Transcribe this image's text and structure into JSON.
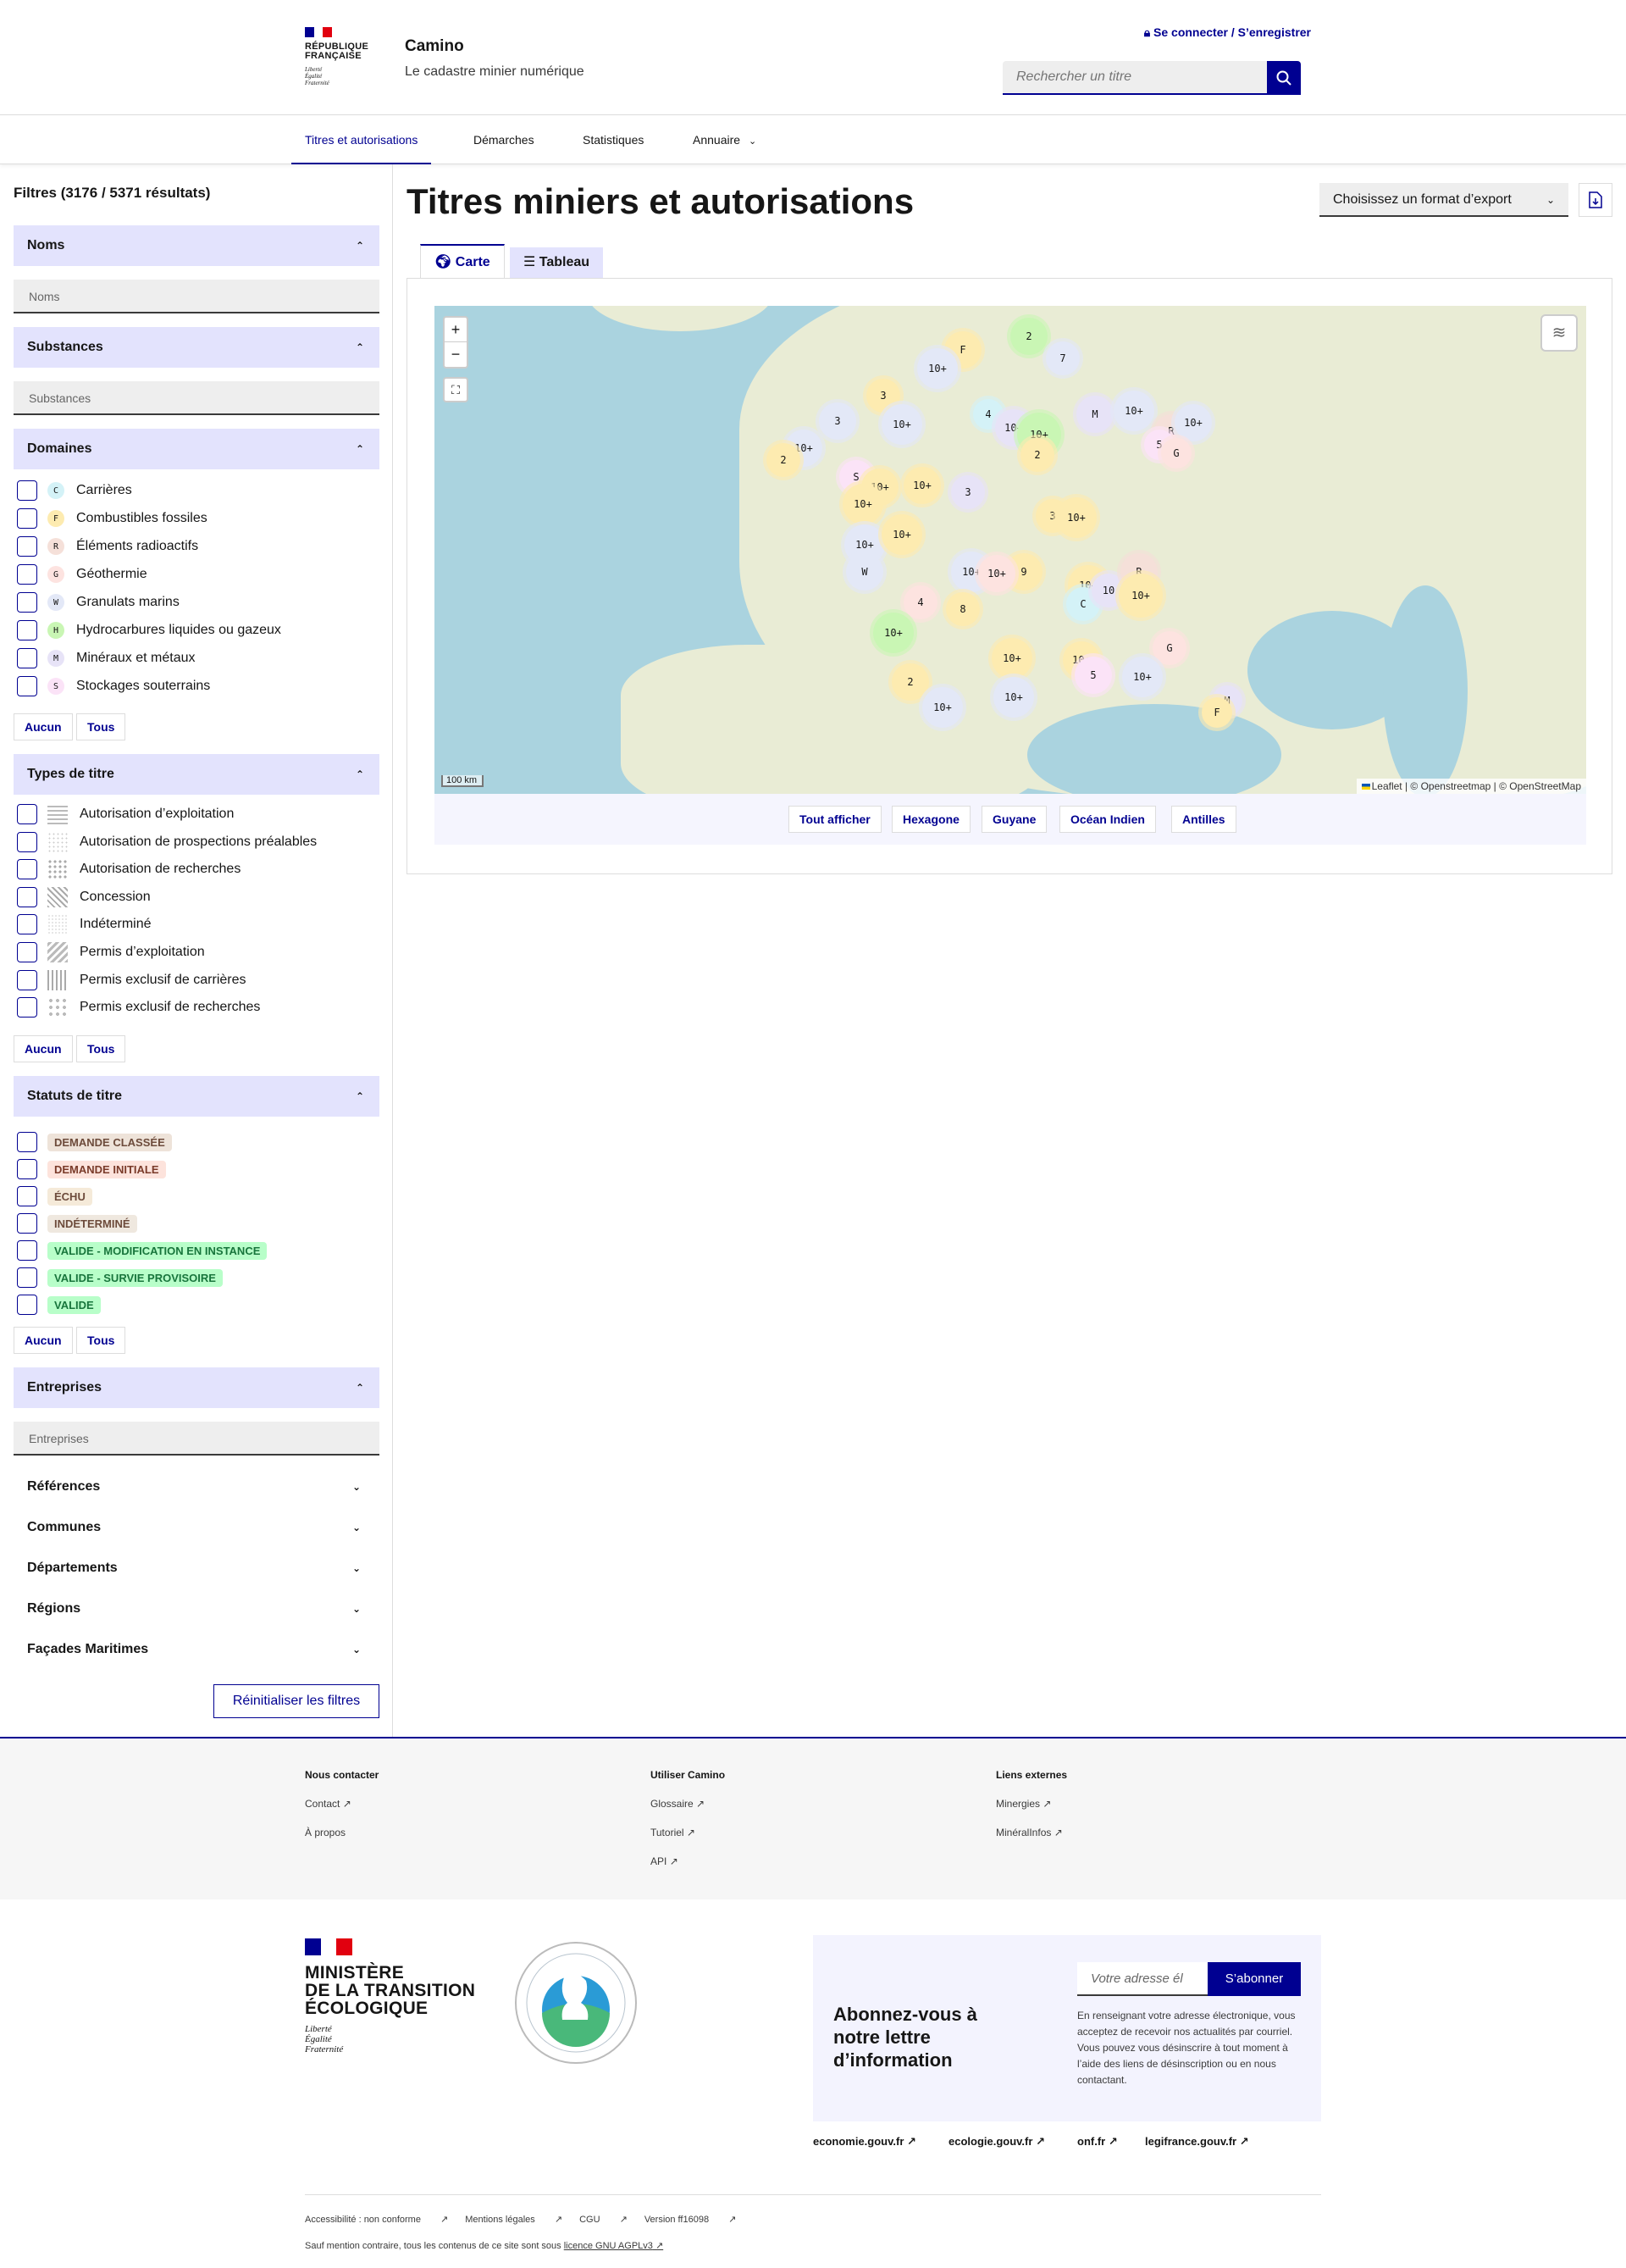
{
  "header": {
    "rf_line1": "RÉPUBLIQUE",
    "rf_line2": "FRANÇAISE",
    "devise1": "Liberté",
    "devise2": "Égalité",
    "devise3": "Fraternité",
    "service_title": "Camino",
    "service_tagline": "Le cadastre minier numérique",
    "login": "Se connecter / S’enregistrer",
    "search_placeholder": "Rechercher un titre"
  },
  "nav": {
    "items": [
      "Titres et autorisations",
      "Démarches",
      "Statistiques",
      "Annuaire"
    ]
  },
  "filters": {
    "title": "Filtres (3176 / 5371 résultats)",
    "noms": {
      "label": "Noms",
      "placeholder": "Noms"
    },
    "substances": {
      "label": "Substances",
      "placeholder": "Substances"
    },
    "domaines": {
      "label": "Domaines",
      "items": [
        {
          "code": "C",
          "label": "Carrières",
          "color": "#d4f2f7"
        },
        {
          "code": "F",
          "label": "Combustibles fossiles",
          "color": "#fdebb0"
        },
        {
          "code": "R",
          "label": "Éléments radioactifs",
          "color": "#f5e0d9"
        },
        {
          "code": "G",
          "label": "Géothermie",
          "color": "#fde3e0"
        },
        {
          "code": "W",
          "label": "Granulats marins",
          "color": "#e3e8f7"
        },
        {
          "code": "H",
          "label": "Hydrocarbures liquides ou gazeux",
          "color": "#c9f6b4"
        },
        {
          "code": "M",
          "label": "Minéraux et métaux",
          "color": "#e7e3f7"
        },
        {
          "code": "S",
          "label": "Stockages souterrains",
          "color": "#fbe3f7"
        }
      ],
      "none": "Aucun",
      "all": "Tous"
    },
    "types": {
      "label": "Types de titre",
      "items": [
        "Autorisation d’exploitation",
        "Autorisation de prospections préalables",
        "Autorisation de recherches",
        "Concession",
        "Indéterminé",
        "Permis d’exploitation",
        "Permis exclusif de carrières",
        "Permis exclusif de recherches"
      ],
      "none": "Aucun",
      "all": "Tous"
    },
    "statuts": {
      "label": "Statuts de titre",
      "items": [
        {
          "label": "Demande classée",
          "bg": "#eee3d9",
          "fg": "#6d4b3b"
        },
        {
          "label": "Demande initiale",
          "bg": "#fde3dc",
          "fg": "#7a3b2a"
        },
        {
          "label": "Échu",
          "bg": "#f5ead9",
          "fg": "#6d4b3b"
        },
        {
          "label": "Indéterminé",
          "bg": "#efe8df",
          "fg": "#6d4b3b"
        },
        {
          "label": "Valide - modification en instance",
          "bg": "#b8fec9",
          "fg": "#18753c"
        },
        {
          "label": "Valide - survie provisoire",
          "bg": "#b8fec9",
          "fg": "#18753c"
        },
        {
          "label": "Valide",
          "bg": "#b8fec9",
          "fg": "#18753c"
        }
      ],
      "none": "Aucun",
      "all": "Tous"
    },
    "entreprises": {
      "label": "Entreprises",
      "placeholder": "Entreprises"
    },
    "more": [
      "Références",
      "Communes",
      "Départements",
      "Régions",
      "Façades Maritimes"
    ],
    "reset": "Réinitialiser les filtres"
  },
  "main": {
    "title": "Titres miniers et autorisations",
    "export": "Choisissez un format d’export",
    "tabs": [
      "Carte",
      "Tableau"
    ],
    "map": {
      "zoom_in": "+",
      "zoom_out": "−",
      "scale": "100 km",
      "attribution": "Leaflet | © Openstreetmap | © OpenStreetMap",
      "clusters": [
        {
          "label": "F",
          "color": "#fdebb0"
        },
        {
          "label": "2",
          "color": "#c9f6b4"
        },
        {
          "label": "7",
          "color": "#e3e8f7"
        },
        {
          "label": "10+",
          "color": "#e3e8f7"
        },
        {
          "label": "3",
          "color": "#fdebb0"
        },
        {
          "label": "3",
          "color": "#e3e8f7"
        },
        {
          "label": "10+",
          "color": "#e3e8f7"
        },
        {
          "label": "4",
          "color": "#d4f2f7"
        },
        {
          "label": "10+",
          "color": "#e7e3f7"
        },
        {
          "label": "10+",
          "color": "#c9f6b4"
        },
        {
          "label": "M",
          "color": "#e7e3f7"
        },
        {
          "label": "10+",
          "color": "#e3e8f7"
        },
        {
          "label": "R",
          "color": "#f5e0d9"
        },
        {
          "label": "10+",
          "color": "#e3e8f7"
        },
        {
          "label": "5",
          "color": "#fbe3f7"
        },
        {
          "label": "G",
          "color": "#fde3e0"
        },
        {
          "label": "2",
          "color": "#fdebb0"
        },
        {
          "label": "10+",
          "color": "#e3e8f7"
        },
        {
          "label": "2",
          "color": "#fdebb0"
        },
        {
          "label": "S",
          "color": "#fbe3f7"
        },
        {
          "label": "10+",
          "color": "#fdebb0"
        },
        {
          "label": "10+",
          "color": "#fdebb0"
        },
        {
          "label": "3",
          "color": "#e7e3f7"
        },
        {
          "label": "10+",
          "color": "#fdebb0"
        },
        {
          "label": "3",
          "color": "#fdebb0"
        },
        {
          "label": "10+",
          "color": "#fdebb0"
        },
        {
          "label": "10+",
          "color": "#e3e8f7"
        },
        {
          "label": "10+",
          "color": "#fdebb0"
        },
        {
          "label": "W",
          "color": "#e3e8f7"
        },
        {
          "label": "10+",
          "color": "#e3e8f7"
        },
        {
          "label": "9",
          "color": "#fdebb0"
        },
        {
          "label": "4",
          "color": "#fde3e0"
        },
        {
          "label": "8",
          "color": "#fdebb0"
        },
        {
          "label": "10+",
          "color": "#fde3e0"
        },
        {
          "label": "10+",
          "color": "#fdebb0"
        },
        {
          "label": "C",
          "color": "#d4f2f7"
        },
        {
          "label": "10",
          "color": "#e7e3f7"
        },
        {
          "label": "R",
          "color": "#f5e0d9"
        },
        {
          "label": "10+",
          "color": "#fdebb0"
        },
        {
          "label": "10+",
          "color": "#c9f6b4"
        },
        {
          "label": "2",
          "color": "#fdebb0"
        },
        {
          "label": "10+",
          "color": "#fdebb0"
        },
        {
          "label": "10+",
          "color": "#fdebb0"
        },
        {
          "label": "5",
          "color": "#fbe3f7"
        },
        {
          "label": "G",
          "color": "#fde3e0"
        },
        {
          "label": "10+",
          "color": "#e3e8f7"
        },
        {
          "label": "10+",
          "color": "#e3e8f7"
        },
        {
          "label": "10+",
          "color": "#e3e8f7"
        },
        {
          "label": "M",
          "color": "#e7e3f7"
        },
        {
          "label": "F",
          "color": "#fdebb0"
        }
      ]
    },
    "map_buttons": [
      "Tout afficher",
      "Hexagone",
      "Guyane",
      "Océan Indien",
      "Antilles"
    ]
  },
  "footer": {
    "contact": {
      "title": "Nous contacter",
      "links": [
        "Contact",
        "À propos"
      ]
    },
    "usage": {
      "title": "Utiliser Camino",
      "links": [
        "Glossaire",
        "Tutoriel",
        "API"
      ]
    },
    "external": {
      "title": "Liens externes",
      "links": [
        "Minergies",
        "MinéralInfos"
      ]
    },
    "ministry": [
      "MINISTÈRE",
      "DE LA TRANSITION",
      "ÉCOLOGIQUE"
    ],
    "newsletter": {
      "title": "Abonnez-vous à notre lettre d’information",
      "placeholder": "Votre adresse él",
      "button": "S’abonner",
      "text": "En renseignant votre adresse électronique, vous acceptez de recevoir nos actualités par courriel. Vous pouvez vous désinscrire à tout moment à l’aide des liens de désinscription ou en nous contactant."
    },
    "gov_links": [
      "economie.gouv.fr",
      "ecologie.gouv.fr",
      "onf.fr",
      "legifrance.gouv.fr"
    ],
    "legal": [
      "Accessibilité : non conforme",
      "Mentions légales",
      "CGU",
      "Version ff16098"
    ],
    "license_prefix": "Sauf mention contraire, tous les contenus de ce site sont sous",
    "license_link": "licence GNU AGPLv3"
  }
}
